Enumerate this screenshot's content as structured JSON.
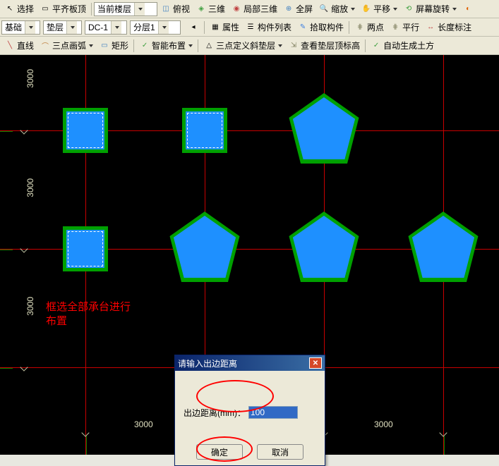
{
  "toolbars": {
    "row1": {
      "select": "选择",
      "align": "平齐板顶",
      "floor": "当前楼层",
      "top_view": "俯视",
      "three_d": "三维",
      "local_3d": "局部三维",
      "fullscreen": "全屏",
      "zoom": "缩放",
      "pan": "平移",
      "screen_rotate": "屏幕旋转"
    },
    "row2": {
      "foundation": "基础",
      "pad": "垫层",
      "dc": "DC-1",
      "layer": "分层1",
      "properties": "属性",
      "component_list": "构件列表",
      "pick_component": "拾取构件",
      "two_point": "两点",
      "parallel": "平行",
      "length_dim": "长度标注"
    },
    "row3": {
      "line": "直线",
      "three_point_arc": "三点画弧",
      "rect": "矩形",
      "smart_layout": "智能布置",
      "slope_define": "三点定义斜垫层",
      "view_pad_elev": "查看垫层顶标高",
      "auto_gen": "自动生成土方"
    }
  },
  "dims": {
    "d1": "3000",
    "d2": "3000",
    "d3": "3000",
    "d4": "3000",
    "d5": "3000",
    "d6": "3000"
  },
  "note": "框选全部承台进行\n布置",
  "dialog": {
    "title": "请输入出边距离",
    "label": "出边距离(mm)：",
    "value": "100",
    "ok": "确定",
    "cancel": "取消"
  }
}
